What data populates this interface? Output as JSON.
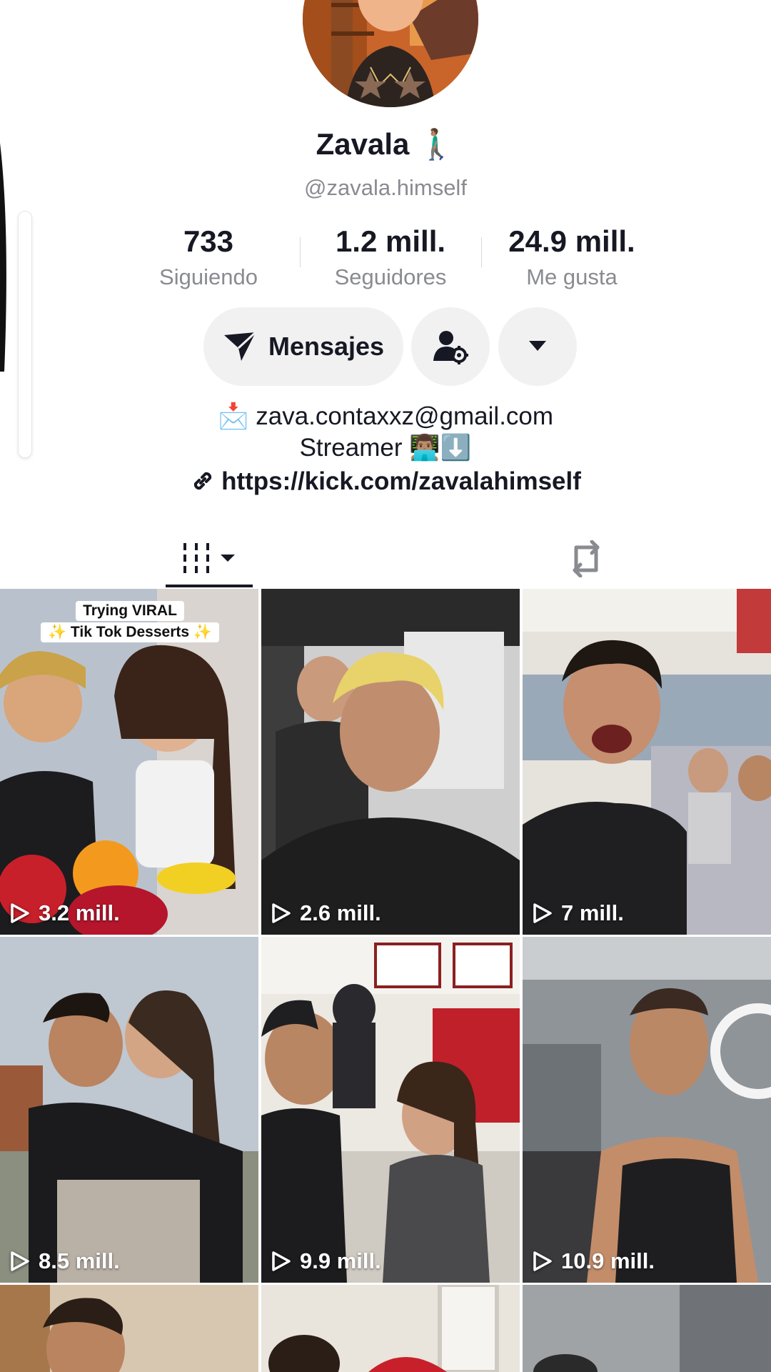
{
  "profile": {
    "display_name": "Zavala 🚶🏽‍♂️",
    "handle": "@zavala.himself"
  },
  "stats": [
    {
      "value": "733",
      "label": "Siguiendo"
    },
    {
      "value": "1.2 mill.",
      "label": "Seguidores"
    },
    {
      "value": "24.9 mill.",
      "label": "Me gusta"
    }
  ],
  "actions": {
    "messages_label": "Mensajes"
  },
  "bio": {
    "email_line": "📩 zava.contaxxz@gmail.com",
    "role_line": "Streamer 👨🏽‍💻⬇️",
    "link": "https://kick.com/zavalahimself"
  },
  "tabs": {
    "videos_icon": "video-grid-icon",
    "reposts_icon": "repost-icon"
  },
  "videos": [
    {
      "views": "3.2 mill.",
      "caption": [
        "Trying VIRAL",
        "✨ Tik Tok Desserts ✨"
      ]
    },
    {
      "views": "2.6 mill."
    },
    {
      "views": "7 mill."
    },
    {
      "views": "8.5 mill."
    },
    {
      "views": "9.9 mill."
    },
    {
      "views": "10.9 mill."
    }
  ],
  "colors": {
    "text_primary": "#161823",
    "text_secondary": "#8a8b91",
    "button_bg": "#f1f1f2"
  }
}
